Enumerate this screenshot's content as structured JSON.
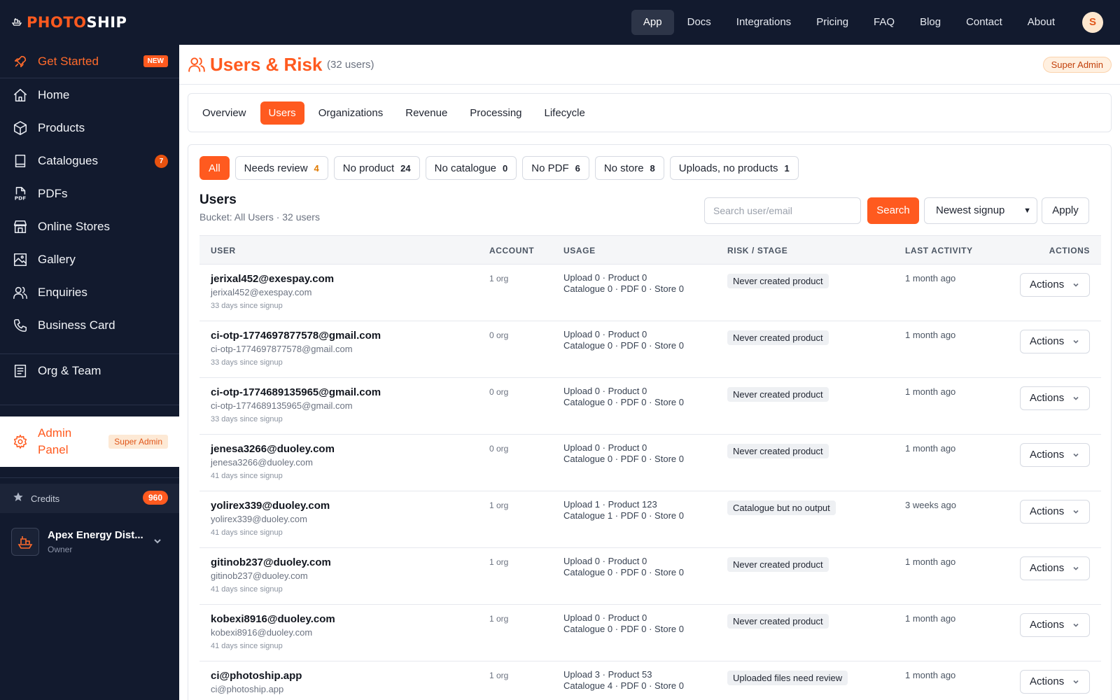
{
  "brand": {
    "part1": "PHOTO",
    "part2": "SHIP"
  },
  "topnav": {
    "items": [
      {
        "label": "App"
      },
      {
        "label": "Docs"
      },
      {
        "label": "Integrations"
      },
      {
        "label": "Pricing"
      },
      {
        "label": "FAQ"
      },
      {
        "label": "Blog"
      },
      {
        "label": "Contact"
      },
      {
        "label": "About"
      }
    ],
    "active": "App",
    "avatar": "S"
  },
  "sidebar": {
    "get_started": {
      "label": "Get Started",
      "badge": "NEW",
      "icon": "rocket-icon"
    },
    "items": [
      {
        "label": "Home",
        "icon": "home-icon"
      },
      {
        "label": "Products",
        "icon": "box-icon"
      },
      {
        "label": "Catalogues",
        "icon": "book-icon",
        "badge": "7"
      },
      {
        "label": "PDFs",
        "icon": "pdf-icon"
      },
      {
        "label": "Online Stores",
        "icon": "store-icon"
      },
      {
        "label": "Gallery",
        "icon": "image-icon"
      },
      {
        "label": "Enquiries",
        "icon": "users-icon"
      },
      {
        "label": "Business Card",
        "icon": "phone-icon"
      }
    ],
    "org_team": {
      "label": "Org & Team",
      "icon": "document-icon"
    },
    "admin": {
      "label": "Admin Panel",
      "badge": "Super Admin",
      "icon": "gear-icon"
    },
    "credits": {
      "label": "Credits",
      "value": "960",
      "icon": "star-icon"
    },
    "org": {
      "name": "Apex Energy Dist...",
      "role": "Owner"
    }
  },
  "header": {
    "title": "Users & Risk",
    "count": "(32 users)",
    "role_badge": "Super Admin"
  },
  "tabs": [
    {
      "label": "Overview"
    },
    {
      "label": "Users"
    },
    {
      "label": "Organizations"
    },
    {
      "label": "Revenue"
    },
    {
      "label": "Processing"
    },
    {
      "label": "Lifecycle"
    }
  ],
  "active_tab": "Users",
  "filters": [
    {
      "label": "All",
      "count": ""
    },
    {
      "label": "Needs review",
      "count": "4"
    },
    {
      "label": "No product",
      "count": "24"
    },
    {
      "label": "No catalogue",
      "count": "0"
    },
    {
      "label": "No PDF",
      "count": "6"
    },
    {
      "label": "No store",
      "count": "8"
    },
    {
      "label": "Uploads, no products",
      "count": "1"
    }
  ],
  "active_filter": "All",
  "list": {
    "title": "Users",
    "subtitle": "Bucket: All Users · 32 users",
    "search_placeholder": "Search user/email",
    "search_label": "Search",
    "sort_value": "Newest signup",
    "apply_label": "Apply"
  },
  "table": {
    "columns": {
      "user": "USER",
      "account": "ACCOUNT",
      "usage": "USAGE",
      "risk": "RISK / STAGE",
      "last": "LAST ACTIVITY",
      "actions": "ACTIONS"
    },
    "action_label": "Actions",
    "rows": [
      {
        "email": "jerixal452@exespay.com",
        "sub": "jerixal452@exespay.com",
        "signup": "33 days since signup",
        "account": "1 org",
        "usage1": "Upload 0 · Product 0",
        "usage2": "Catalogue 0 · PDF 0 · Store 0",
        "risk": "Never created product",
        "last": "1 month ago"
      },
      {
        "email": "ci-otp-1774697877578@gmail.com",
        "sub": "ci-otp-1774697877578@gmail.com",
        "signup": "33 days since signup",
        "account": "0 org",
        "usage1": "Upload 0 · Product 0",
        "usage2": "Catalogue 0 · PDF 0 · Store 0",
        "risk": "Never created product",
        "last": "1 month ago"
      },
      {
        "email": "ci-otp-1774689135965@gmail.com",
        "sub": "ci-otp-1774689135965@gmail.com",
        "signup": "33 days since signup",
        "account": "0 org",
        "usage1": "Upload 0 · Product 0",
        "usage2": "Catalogue 0 · PDF 0 · Store 0",
        "risk": "Never created product",
        "last": "1 month ago"
      },
      {
        "email": "jenesa3266@duoley.com",
        "sub": "jenesa3266@duoley.com",
        "signup": "41 days since signup",
        "account": "0 org",
        "usage1": "Upload 0 · Product 0",
        "usage2": "Catalogue 0 · PDF 0 · Store 0",
        "risk": "Never created product",
        "last": "1 month ago"
      },
      {
        "email": "yolirex339@duoley.com",
        "sub": "yolirex339@duoley.com",
        "signup": "41 days since signup",
        "account": "1 org",
        "usage1": "Upload 1 · Product 123",
        "usage2": "Catalogue 1 · PDF 0 · Store 0",
        "risk": "Catalogue but no output",
        "last": "3 weeks ago"
      },
      {
        "email": "gitinob237@duoley.com",
        "sub": "gitinob237@duoley.com",
        "signup": "41 days since signup",
        "account": "1 org",
        "usage1": "Upload 0 · Product 0",
        "usage2": "Catalogue 0 · PDF 0 · Store 0",
        "risk": "Never created product",
        "last": "1 month ago"
      },
      {
        "email": "kobexi8916@duoley.com",
        "sub": "kobexi8916@duoley.com",
        "signup": "41 days since signup",
        "account": "1 org",
        "usage1": "Upload 0 · Product 0",
        "usage2": "Catalogue 0 · PDF 0 · Store 0",
        "risk": "Never created product",
        "last": "1 month ago"
      },
      {
        "email": "ci@photoship.app",
        "sub": "ci@photoship.app",
        "signup": "",
        "account": "1 org",
        "usage1": "Upload 3 · Product 53",
        "usage2": "Catalogue 4 · PDF 0 · Store 0",
        "risk": "Uploaded files need review",
        "last": "1 month ago"
      }
    ]
  },
  "colors": {
    "accent": "#ff5a1f",
    "sidebar_bg": "#121a2e"
  }
}
